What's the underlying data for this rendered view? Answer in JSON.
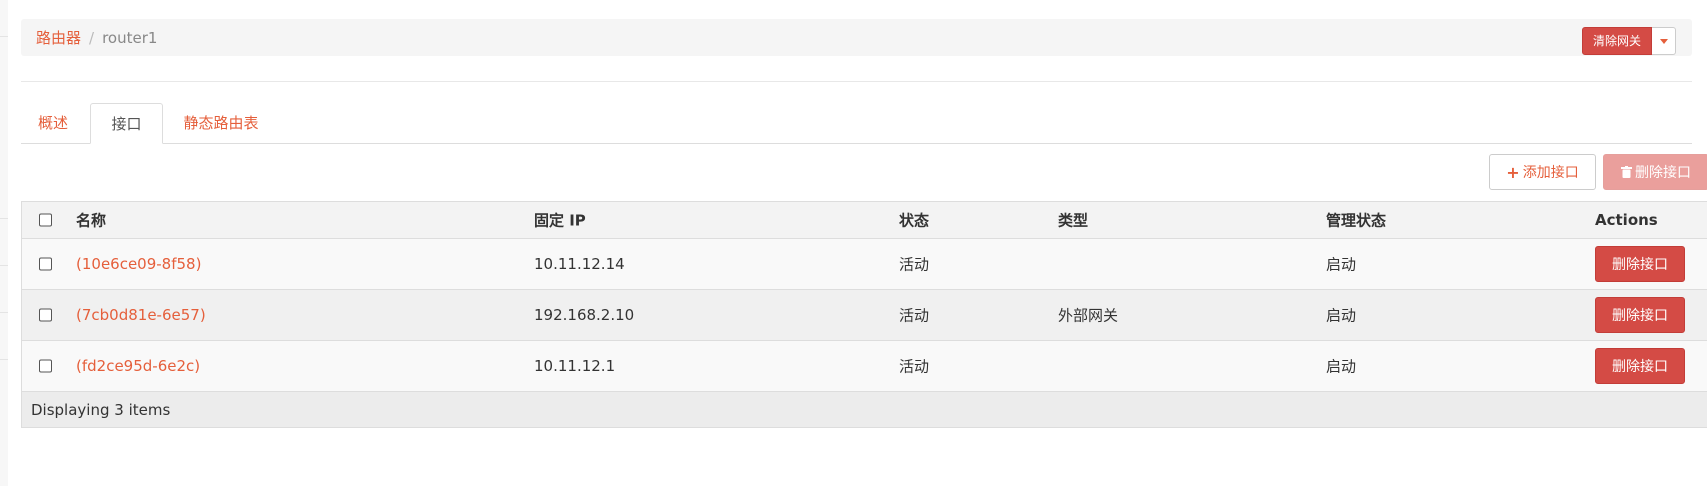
{
  "breadcrumb": {
    "parent": "路由器",
    "separator": "/",
    "current": "router1"
  },
  "header_actions": {
    "clear_gateway": "清除网关"
  },
  "tabs": [
    {
      "label": "概述",
      "active": false
    },
    {
      "label": "接口",
      "active": true
    },
    {
      "label": "静态路由表",
      "active": false
    }
  ],
  "toolbar": {
    "add_interface": "添加接口",
    "delete_interfaces": "删除接口"
  },
  "table": {
    "columns": [
      "名称",
      "固定 IP",
      "状态",
      "类型",
      "管理状态",
      "Actions"
    ],
    "rows": [
      {
        "name": "(10e6ce09-8f58)",
        "fixed_ip": "10.11.12.14",
        "status": "活动",
        "type": "",
        "admin_state": "启动",
        "action": "删除接口"
      },
      {
        "name": "(7cb0d81e-6e57)",
        "fixed_ip": "192.168.2.10",
        "status": "活动",
        "type": "外部网关",
        "admin_state": "启动",
        "action": "删除接口"
      },
      {
        "name": "(fd2ce95d-6e2c)",
        "fixed_ip": "10.11.12.1",
        "status": "活动",
        "type": "",
        "admin_state": "启动",
        "action": "删除接口"
      }
    ],
    "footer": "Displaying 3 items"
  },
  "colors": {
    "accent": "#e55f3b",
    "danger": "#d44b45"
  }
}
